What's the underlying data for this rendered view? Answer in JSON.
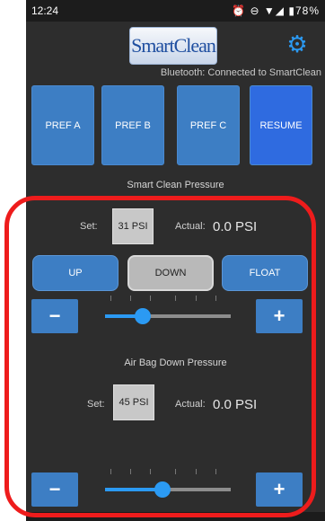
{
  "status_bar": {
    "time": "12:24",
    "icons_text": "⏰ ⊖ ▼◢ ▮78%",
    "battery": "78%"
  },
  "header": {
    "logo_text": "SmartClean",
    "settings_icon": "gear-icon",
    "bluetooth_status": "Bluetooth: Connected to SmartClean"
  },
  "presets": [
    {
      "label": "PREF A"
    },
    {
      "label": "PREF B"
    },
    {
      "label": "PREF C"
    },
    {
      "label": "RESUME"
    }
  ],
  "smart_clean_pressure": {
    "title": "Smart Clean Pressure",
    "set_label": "Set:",
    "set_value": "31 PSI",
    "actual_label": "Actual:",
    "actual_value": "0.0 PSI",
    "modes": [
      {
        "label": "UP",
        "selected": false
      },
      {
        "label": "DOWN",
        "selected": true
      },
      {
        "label": "FLOAT",
        "selected": false
      }
    ],
    "minus_label": "−",
    "plus_label": "+",
    "slider_fraction": 0.3
  },
  "air_bag_down_pressure": {
    "title": "Air Bag Down Pressure",
    "set_label": "Set:",
    "set_value": "45 PSI",
    "actual_label": "Actual:",
    "actual_value": "0.0 PSI",
    "minus_label": "−",
    "plus_label": "+",
    "slider_fraction": 0.46
  },
  "colors": {
    "accent_blue": "#3d7ec4",
    "slider_blue": "#2b9af3",
    "background": "#2d2d2d",
    "highlight_red": "#ee1c1c"
  }
}
